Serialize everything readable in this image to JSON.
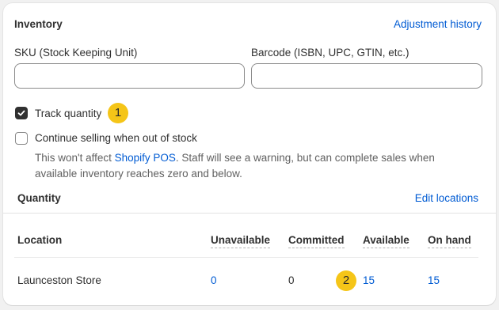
{
  "inventory": {
    "title": "Inventory",
    "adjustment_history_link": "Adjustment history",
    "sku_label": "SKU (Stock Keeping Unit)",
    "sku_value": "",
    "barcode_label": "Barcode (ISBN, UPC, GTIN, etc.)",
    "barcode_value": "",
    "track_quantity": {
      "label": "Track quantity",
      "checked": true
    },
    "continue_selling": {
      "label": "Continue selling when out of stock",
      "checked": false
    },
    "help_text_before": "This won't affect ",
    "help_link": "Shopify POS",
    "help_text_after": ". Staff will see a warning, but can complete sales when available inventory reaches zero and below."
  },
  "annotations": {
    "badge_1": "1",
    "badge_2": "2",
    "badge_color": "#f5c518"
  },
  "quantity": {
    "title": "Quantity",
    "edit_locations_link": "Edit locations",
    "columns": [
      "Location",
      "Unavailable",
      "Committed",
      "Available",
      "On hand"
    ],
    "rows": [
      {
        "location": "Launceston Store",
        "unavailable": "0",
        "committed": "0",
        "available": "15",
        "on_hand": "15"
      }
    ]
  },
  "colors": {
    "link": "#005bd3",
    "text": "#303030",
    "muted": "#616161"
  }
}
